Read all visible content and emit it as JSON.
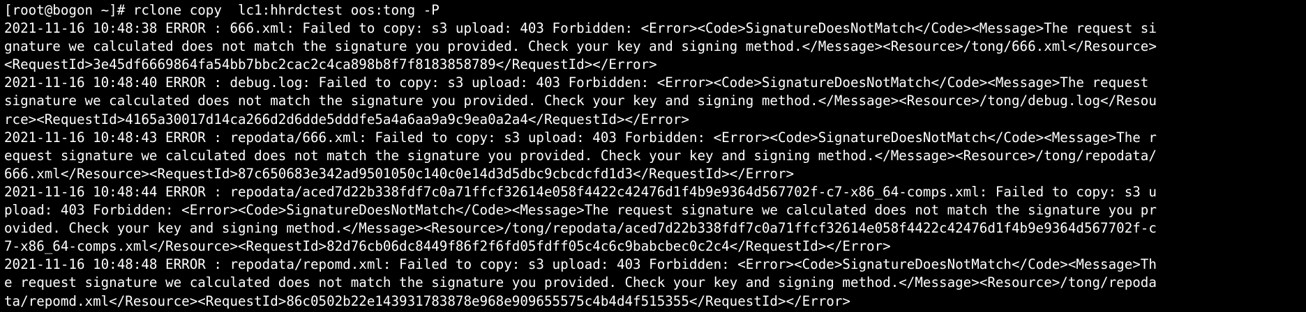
{
  "terminal": {
    "background": "#000000",
    "foreground": "#ffffff",
    "lines": [
      "[root@bogon ~]# rclone copy  lc1:hhrdctest oos:tong -P",
      "2021-11-16 10:48:38 ERROR : 666.xml: Failed to copy: s3 upload: 403 Forbidden: <Error><Code>SignatureDoesNotMatch</Code><Message>The request si",
      "gnature we calculated does not match the signature you provided. Check your key and signing method.</Message><Resource>/tong/666.xml</Resource>",
      "<RequestId>3e45df6669864fa54bb7bbc2cac2c4ca898b8f7f8183858789</RequestId></Error>",
      "2021-11-16 10:48:40 ERROR : debug.log: Failed to copy: s3 upload: 403 Forbidden: <Error><Code>SignatureDoesNotMatch</Code><Message>The request ",
      "signature we calculated does not match the signature you provided. Check your key and signing method.</Message><Resource>/tong/debug.log</Resou",
      "rce><RequestId>4165a30017d14ca266d2d6dde5dddfe5a4a6aa9a9c9ea0a2a4</RequestId></Error>",
      "2021-11-16 10:48:43 ERROR : repodata/666.xml: Failed to copy: s3 upload: 403 Forbidden: <Error><Code>SignatureDoesNotMatch</Code><Message>The r",
      "equest signature we calculated does not match the signature you provided. Check your key and signing method.</Message><Resource>/tong/repodata/",
      "666.xml</Resource><RequestId>87c650683e342ad9501050c140c0e14d3d5dbc9cbcdcfd1d3</RequestId></Error>",
      "2021-11-16 10:48:44 ERROR : repodata/aced7d22b338fdf7c0a71ffcf32614e058f4422c42476d1f4b9e9364d567702f-c7-x86_64-comps.xml: Failed to copy: s3 u",
      "pload: 403 Forbidden: <Error><Code>SignatureDoesNotMatch</Code><Message>The request signature we calculated does not match the signature you pr",
      "ovided. Check your key and signing method.</Message><Resource>/tong/repodata/aced7d22b338fdf7c0a71ffcf32614e058f4422c42476d1f4b9e9364d567702f-c",
      "7-x86_64-comps.xml</Resource><RequestId>82d76cb06dc8449f86f2f6fd05fdff05c4c6c9babcbec0c2c4</RequestId></Error>",
      "2021-11-16 10:48:48 ERROR : repodata/repomd.xml: Failed to copy: s3 upload: 403 Forbidden: <Error><Code>SignatureDoesNotMatch</Code><Message>Th",
      "e request signature we calculated does not match the signature you provided. Check your key and signing method.</Message><Resource>/tong/repoda",
      "ta/repomd.xml</Resource><RequestId>86c0502b22e143931783878e968e909655575c4b4d4f515355</RequestId></Error>"
    ]
  }
}
